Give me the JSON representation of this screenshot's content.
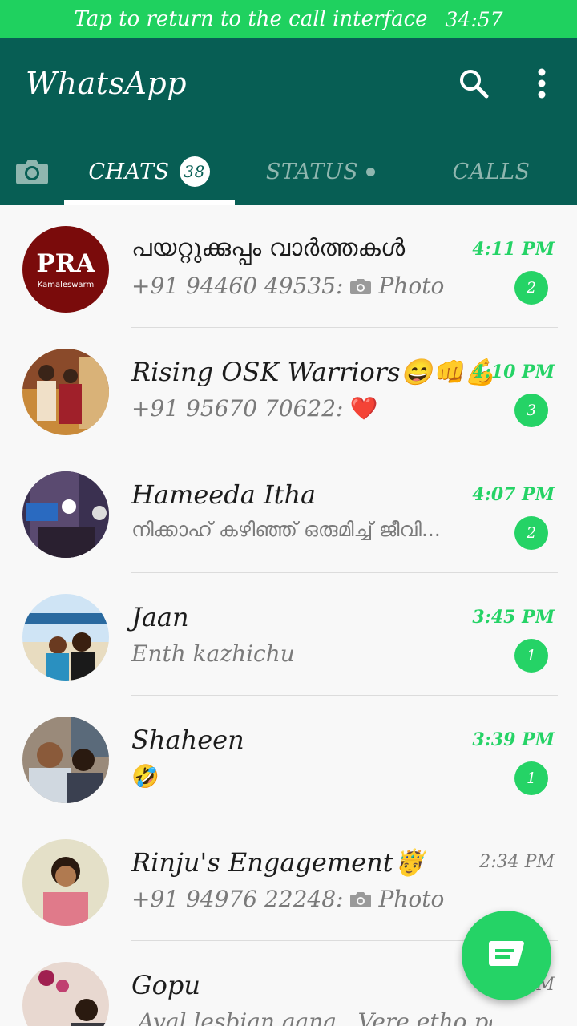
{
  "call_banner": {
    "text": "Tap to return to the call interface",
    "timer": "34:57"
  },
  "app": {
    "title": "WhatsApp"
  },
  "icons": {
    "search": "search-icon",
    "menu": "more-vert-icon",
    "camera": "camera-icon",
    "fab": "new-chat-icon"
  },
  "tabs": [
    {
      "label": "CHATS",
      "badge": "38",
      "active": true
    },
    {
      "label": "STATUS",
      "dot": true
    },
    {
      "label": "CALLS"
    }
  ],
  "colors": {
    "primary": "#075e54",
    "accent": "#25d366",
    "call_banner": "#1fd15f"
  },
  "chats": [
    {
      "name": "പയറ്റുക്കുപ്പം വാർത്തകൾ",
      "sender": "+91 94460 49535:",
      "preview": "Photo",
      "time": "4:11 PM",
      "unread": "2",
      "avatar_text": "PRA",
      "avatar_subtext": "Kamaleswarm"
    },
    {
      "name": "Rising OSK Warriors😄👊💪",
      "sender": "+91 95670 70622:",
      "preview": "❤️",
      "time": "4:10 PM",
      "unread": "3"
    },
    {
      "name": "Hameeda Itha",
      "preview": "നിക്കാഹ് കഴിഞ്ഞ് ഒരുമിച്ച് ജീവി...",
      "time": "4:07 PM",
      "unread": "2"
    },
    {
      "name": "Jaan",
      "preview": "Enth kazhichu",
      "time": "3:45 PM",
      "unread": "1"
    },
    {
      "name": "Shaheen",
      "preview": "🤣",
      "time": "3:39 PM",
      "unread": "1"
    },
    {
      "name": "Rinju's Engagement🤴",
      "sender": "+91 94976 22248:",
      "preview": "Photo",
      "time": "2:34 PM"
    },
    {
      "name": "Gopu",
      "preview": "Aval lesbian aana.. Vere etho pen",
      "time": "PM"
    }
  ]
}
